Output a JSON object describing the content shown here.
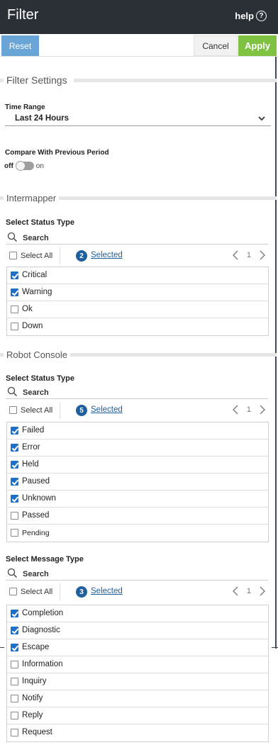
{
  "header": {
    "title": "Filter",
    "help_label": "help",
    "help_glyph": "?"
  },
  "actions": {
    "reset": "Reset",
    "cancel": "Cancel",
    "apply": "Apply"
  },
  "filter_settings": {
    "heading": "Filter Settings",
    "time_range_label": "Time Range",
    "time_range_value": "Last 24 Hours",
    "compare_label": "Compare With Previous Period",
    "toggle_off": "off",
    "toggle_on": "on",
    "compare_enabled": false
  },
  "intermapper": {
    "heading": "Intermapper",
    "status": {
      "label": "Select Status Type",
      "search_placeholder": "Search",
      "select_all": "Select All",
      "selected_count": "2",
      "selected_label": "Selected",
      "page": "1",
      "items": [
        {
          "label": "Critical",
          "checked": true
        },
        {
          "label": "Warning",
          "checked": true
        },
        {
          "label": "Ok",
          "checked": false
        },
        {
          "label": "Down",
          "checked": false
        }
      ]
    }
  },
  "robot_console": {
    "heading": "Robot Console",
    "status": {
      "label": "Select Status Type",
      "search_placeholder": "Search",
      "select_all": "Select All",
      "selected_count": "5",
      "selected_label": "Selected",
      "page": "1",
      "items": [
        {
          "label": "Failed",
          "checked": true
        },
        {
          "label": "Error",
          "checked": true
        },
        {
          "label": "Held",
          "checked": true
        },
        {
          "label": "Paused",
          "checked": true
        },
        {
          "label": "Unknown",
          "checked": true
        },
        {
          "label": "Passed",
          "checked": false
        },
        {
          "label": "Pending",
          "checked": false
        }
      ]
    },
    "message": {
      "label": "Select Message Type",
      "search_placeholder": "Search",
      "select_all": "Select All",
      "selected_count": "3",
      "selected_label": "Selected",
      "page": "1",
      "items": [
        {
          "label": "Completion",
          "checked": true
        },
        {
          "label": "Diagnostic",
          "checked": true
        },
        {
          "label": "Escape",
          "checked": true
        },
        {
          "label": "Information",
          "checked": false
        },
        {
          "label": "Inquiry",
          "checked": false
        },
        {
          "label": "Notify",
          "checked": false
        },
        {
          "label": "Reply",
          "checked": false
        },
        {
          "label": "Request",
          "checked": false
        }
      ]
    }
  }
}
